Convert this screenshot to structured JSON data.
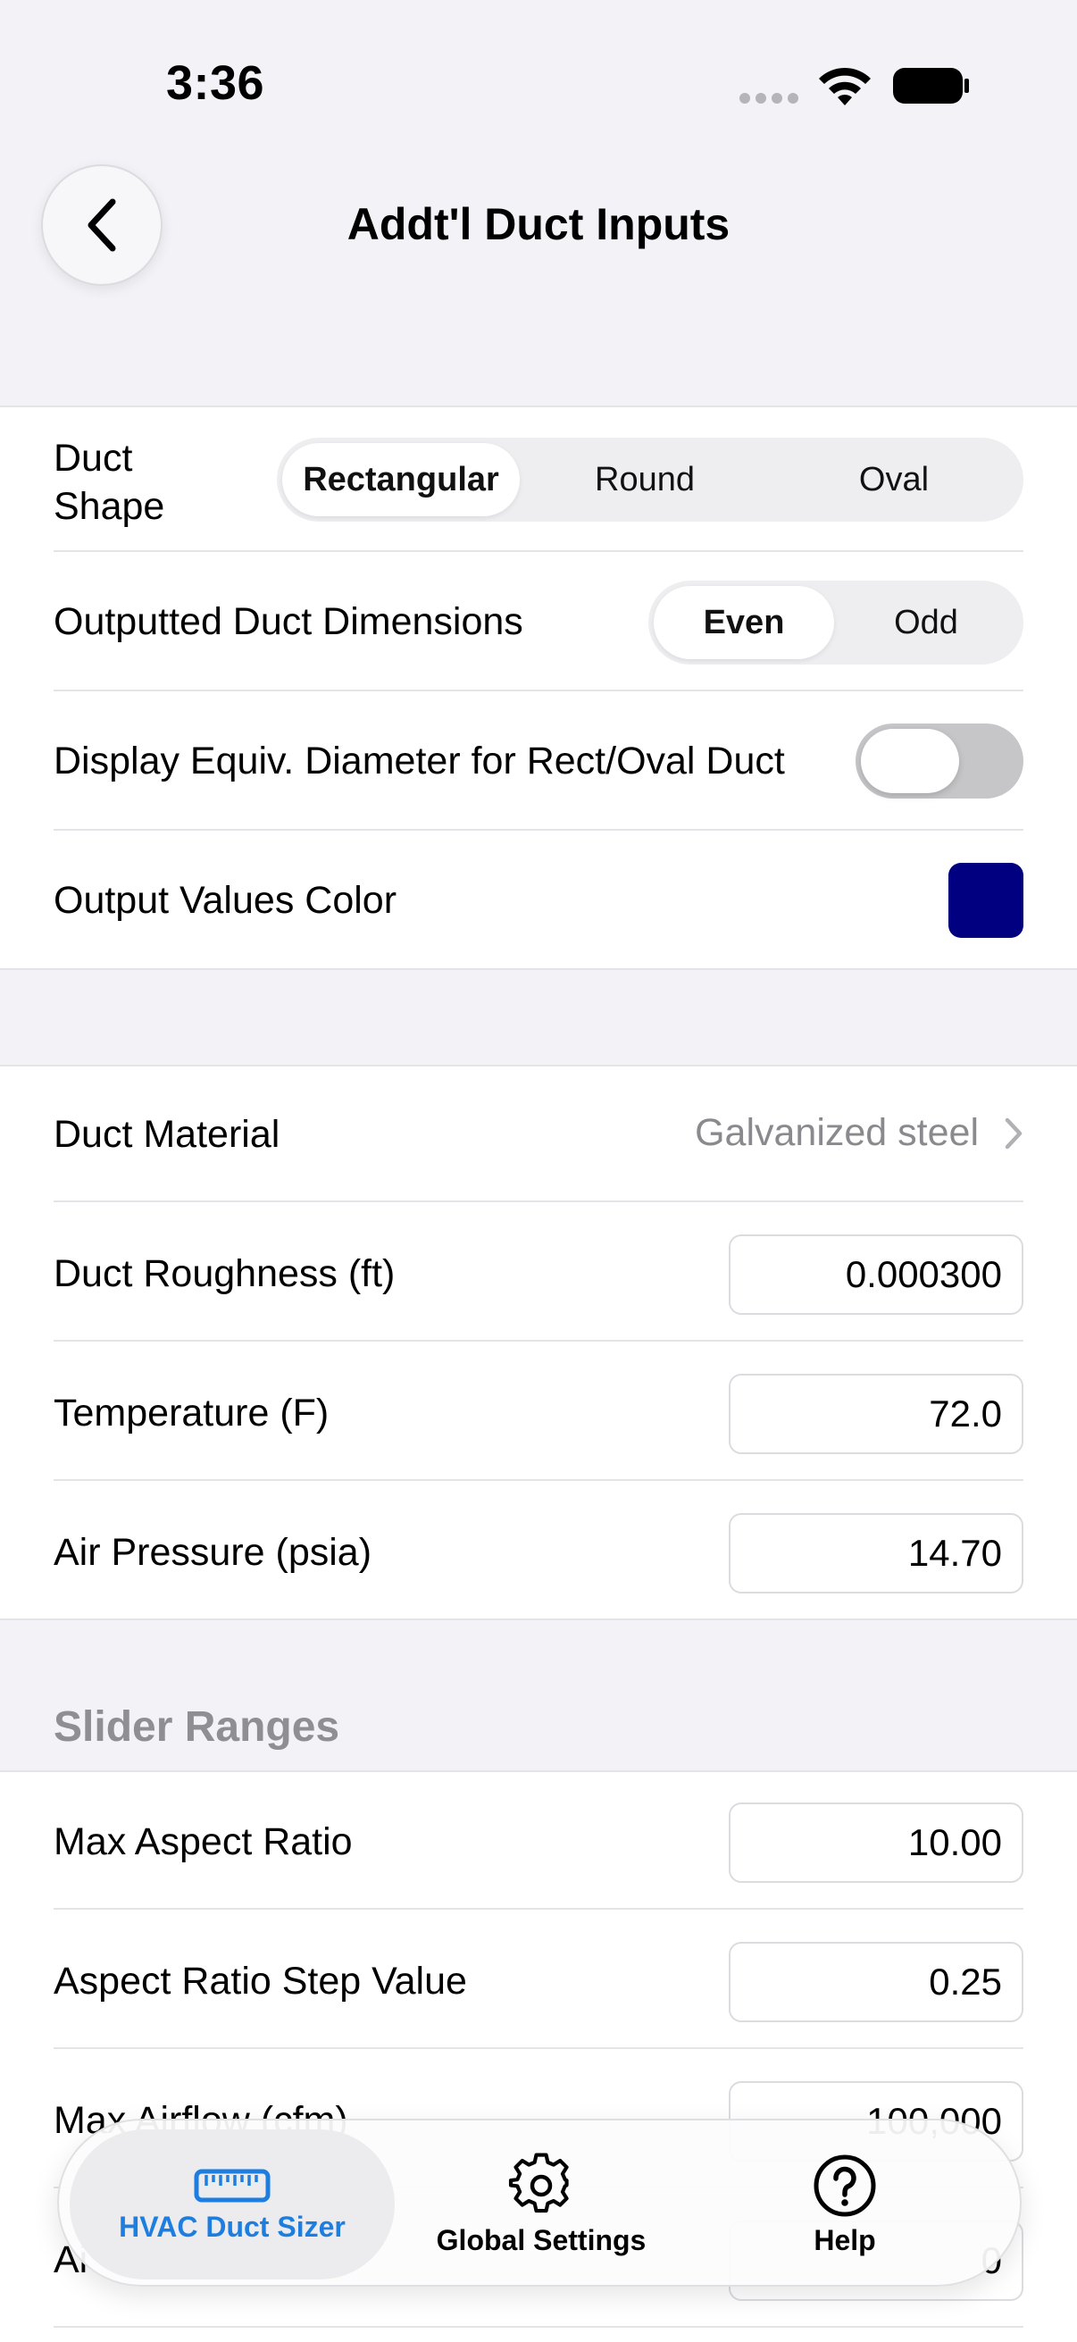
{
  "status": {
    "time": "3:36"
  },
  "nav": {
    "title": "Addt'l Duct Inputs"
  },
  "group1": {
    "duct_shape": {
      "label_line1": "Duct",
      "label_line2": "Shape",
      "options": [
        "Rectangular",
        "Round",
        "Oval"
      ],
      "selected": "Rectangular"
    },
    "dimensions": {
      "label": "Outputted Duct Dimensions",
      "options": [
        "Even",
        "Odd"
      ],
      "selected": "Even"
    },
    "equiv_diameter": {
      "label": "Display Equiv. Diameter for Rect/Oval Duct",
      "on": false
    },
    "output_color": {
      "label": "Output Values Color",
      "color": "#000080"
    }
  },
  "group2": {
    "material": {
      "label": "Duct Material",
      "value": "Galvanized steel"
    },
    "roughness": {
      "label": "Duct Roughness (ft)",
      "value": "0.000300"
    },
    "temperature": {
      "label": "Temperature (F)",
      "value": "72.0"
    },
    "pressure": {
      "label": "Air Pressure (psia)",
      "value": "14.70"
    }
  },
  "slider_ranges": {
    "header": "Slider Ranges",
    "max_aspect": {
      "label": "Max Aspect Ratio",
      "value": "10.00"
    },
    "aspect_step": {
      "label": "Aspect Ratio Step Value",
      "value": "0.25"
    },
    "max_airflow": {
      "label": "Max Airflow (cfm)",
      "value": "100,000"
    },
    "partial_label": "Ai",
    "partial_value": "0"
  },
  "tabs": [
    {
      "label": "HVAC Duct Sizer",
      "icon": "ruler-icon",
      "active": true
    },
    {
      "label": "Global Settings",
      "icon": "gear-icon",
      "active": false
    },
    {
      "label": "Help",
      "icon": "question-circle-icon",
      "active": false
    }
  ],
  "colors": {
    "accent": "#1e7ee0",
    "output": "#000080"
  }
}
